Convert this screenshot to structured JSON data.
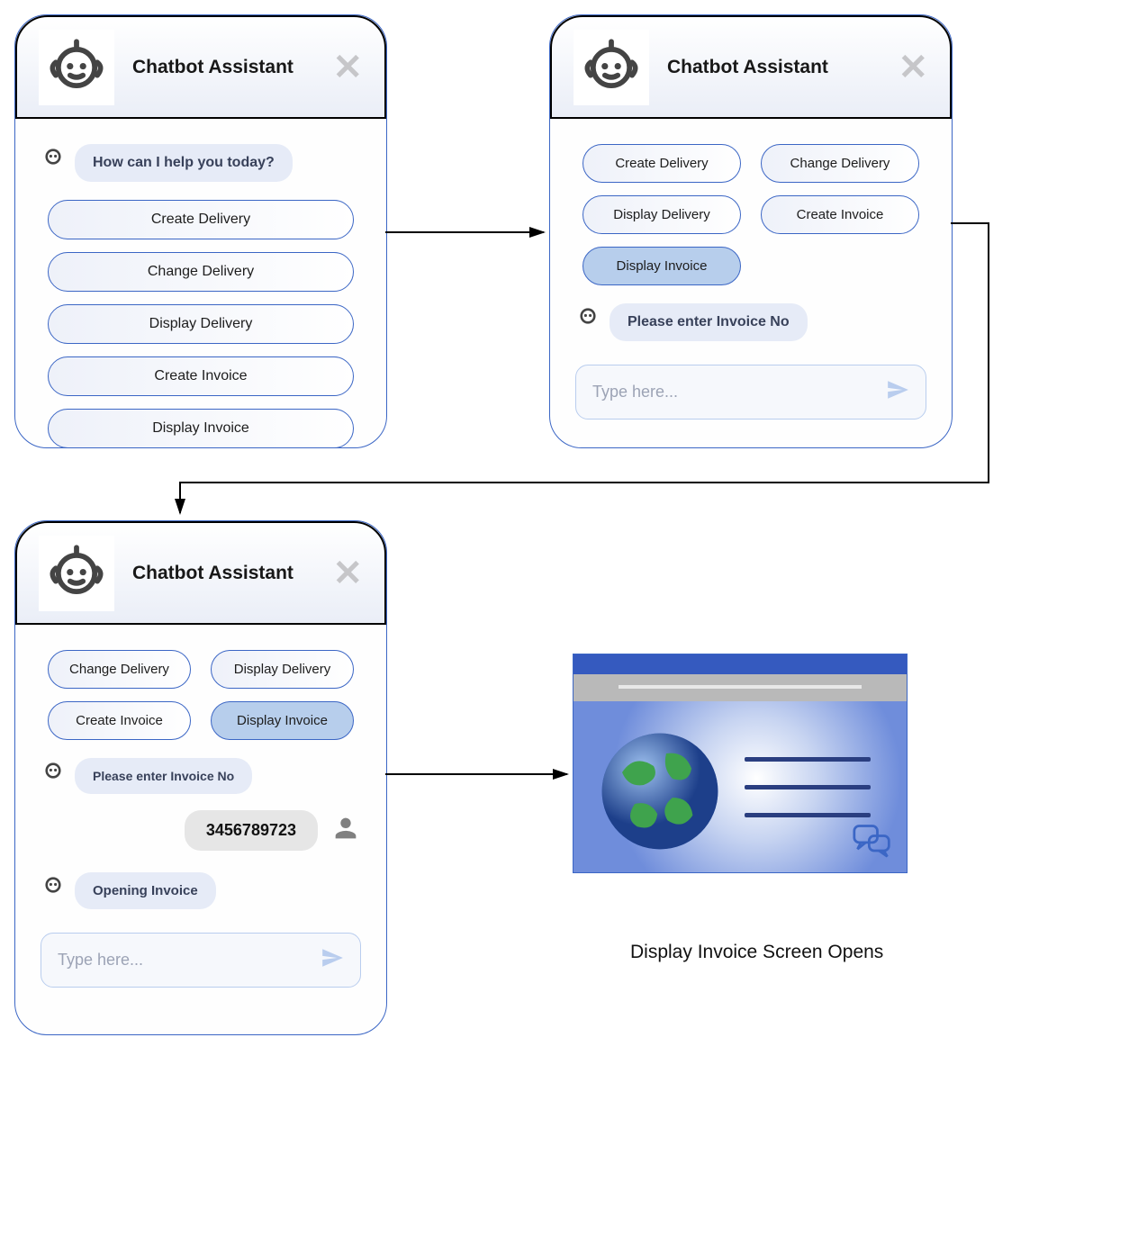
{
  "panels": {
    "p1": {
      "title": "Chatbot Assistant",
      "prompt": "How can I help you today?",
      "options": [
        "Create Delivery",
        "Change Delivery",
        "Display Delivery",
        "Create Invoice",
        "Display Invoice"
      ]
    },
    "p2": {
      "title": "Chatbot Assistant",
      "options": [
        "Create Delivery",
        "Change Delivery",
        "Display Delivery",
        "Create Invoice",
        "Display Invoice"
      ],
      "selected_index": 4,
      "bot_msg": "Please enter  Invoice No",
      "input_placeholder": "Type here..."
    },
    "p3": {
      "title": "Chatbot Assistant",
      "options": [
        "Change Delivery",
        "Display Delivery",
        "Create Invoice",
        "Display Invoice"
      ],
      "selected_index": 3,
      "bot_msg1": "Please enter  Invoice No",
      "user_msg": "3456789723",
      "bot_msg2": "Opening  Invoice",
      "input_placeholder": "Type here..."
    }
  },
  "caption": "Display  Invoice Screen Opens"
}
